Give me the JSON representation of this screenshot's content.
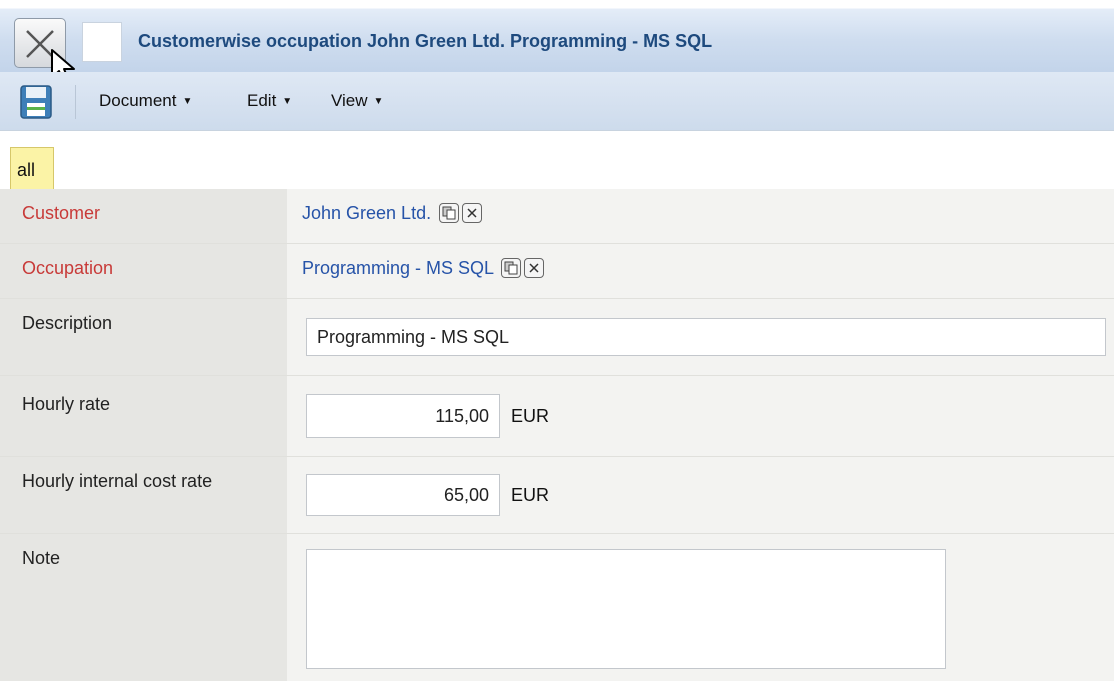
{
  "window": {
    "title": "Customerwise occupation John Green Ltd. Programming - MS SQL",
    "close_icon": "close-x-icon"
  },
  "toolbar": {
    "save_icon": "floppy-disk-icon",
    "menus": [
      {
        "label": "Document"
      },
      {
        "label": "Edit"
      },
      {
        "label": "View"
      }
    ]
  },
  "tabs": [
    {
      "label": "all",
      "active": true
    }
  ],
  "form": {
    "customer": {
      "label": "Customer",
      "value": "John Green Ltd."
    },
    "occupation": {
      "label": "Occupation",
      "value": "Programming - MS SQL"
    },
    "description": {
      "label": "Description",
      "value": "Programming - MS SQL"
    },
    "hourly_rate": {
      "label": "Hourly rate",
      "value": "115,00",
      "unit": "EUR"
    },
    "internal_cost_rate": {
      "label": "Hourly internal cost rate",
      "value": "65,00",
      "unit": "EUR"
    },
    "note": {
      "label": "Note",
      "value": ""
    }
  },
  "colors": {
    "title_text": "#1e4a7e",
    "required_label": "#c83a38",
    "link": "#2653a8",
    "active_tab": "#fbf3a6"
  }
}
